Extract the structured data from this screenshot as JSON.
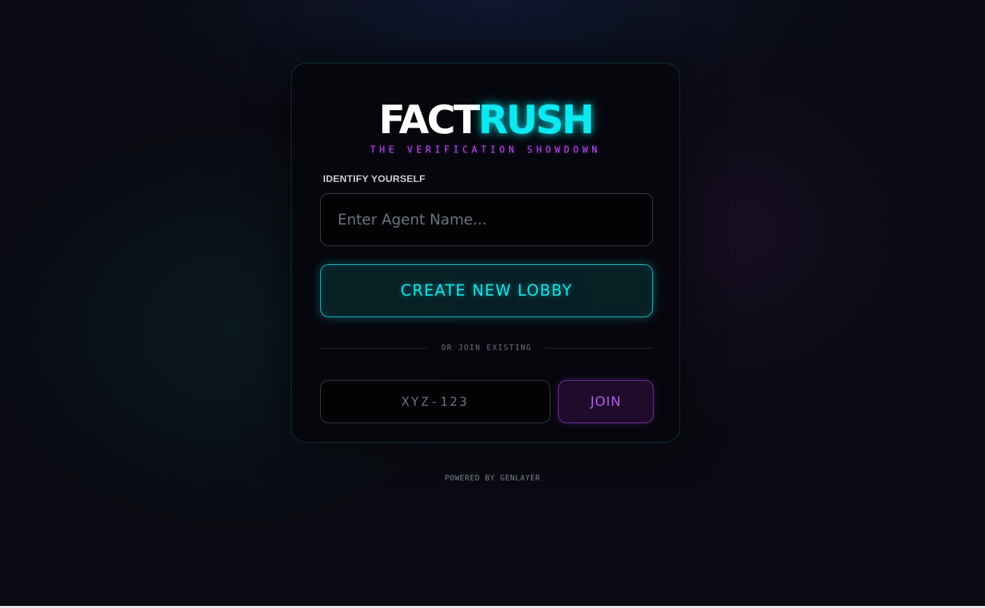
{
  "brand": {
    "logo_part1": "FACT",
    "logo_part2": "RUSH",
    "tagline": "THE VERIFICATION SHOWDOWN",
    "primary_color": "#0ee8f0",
    "accent_color": "#b44cf0"
  },
  "identify": {
    "label": "IDENTIFY YOURSELF",
    "name_placeholder": "Enter Agent Name...",
    "name_value": ""
  },
  "actions": {
    "create_label": "CREATE NEW LOBBY",
    "divider_text": "OR JOIN EXISTING",
    "code_placeholder": "XYZ-123",
    "code_value": "",
    "join_label": "JOIN"
  },
  "footer": {
    "text": "POWERED BY GENLAYER"
  }
}
